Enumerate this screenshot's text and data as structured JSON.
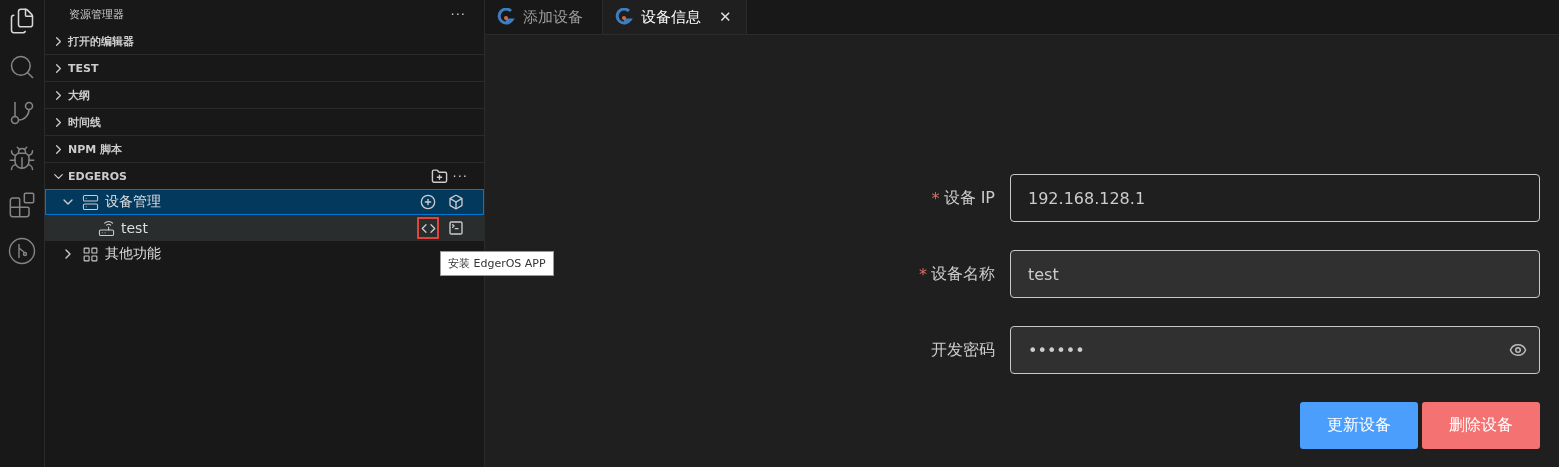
{
  "activity_bar": [
    {
      "kind": "files",
      "selected": true
    },
    {
      "kind": "search",
      "selected": false
    },
    {
      "kind": "source",
      "selected": false
    },
    {
      "kind": "debug",
      "selected": false
    },
    {
      "kind": "extensions",
      "selected": false
    },
    {
      "kind": "edgeros",
      "selected": false
    }
  ],
  "sidebar": {
    "title": "资源管理器",
    "more": "···",
    "sections": [
      {
        "label": "打开的编辑器",
        "expanded": false
      },
      {
        "label": "TEST",
        "expanded": false
      },
      {
        "label": "大纲",
        "expanded": false
      },
      {
        "label": "时间线",
        "expanded": false
      },
      {
        "label": "NPM 脚本",
        "expanded": false
      },
      {
        "label": "EDGEROS",
        "expanded": true,
        "more": "···",
        "tree": [
          {
            "label": "设备管理",
            "kind": "manager",
            "expanded": true,
            "selected": true,
            "hovered": false,
            "children": [
              {
                "label": "test",
                "kind": "device",
                "selected": false,
                "hovered": true,
                "highlighted_action": true
              }
            ]
          },
          {
            "label": "其他功能",
            "kind": "other",
            "expanded": false,
            "selected": false,
            "hovered": false
          }
        ]
      }
    ],
    "tooltip": "安装 EdgerOS APP"
  },
  "tabs": [
    {
      "label": "添加设备",
      "selected": false
    },
    {
      "label": "设备信息",
      "selected": true,
      "close": "✕"
    }
  ],
  "form": {
    "fields": [
      {
        "label": "设备 IP",
        "required_mark": "*",
        "value": "192.168.128.1",
        "kind": "text",
        "focused": true
      },
      {
        "label": "设备名称",
        "required_mark": "*",
        "value": "test",
        "kind": "text",
        "focused": false
      },
      {
        "label": "开发密码",
        "value": "••••••",
        "kind": "password",
        "focused": false
      }
    ],
    "buttons": [
      {
        "label": "更新设备",
        "kind": "primary"
      },
      {
        "label": "删除设备",
        "kind": "danger"
      }
    ]
  }
}
